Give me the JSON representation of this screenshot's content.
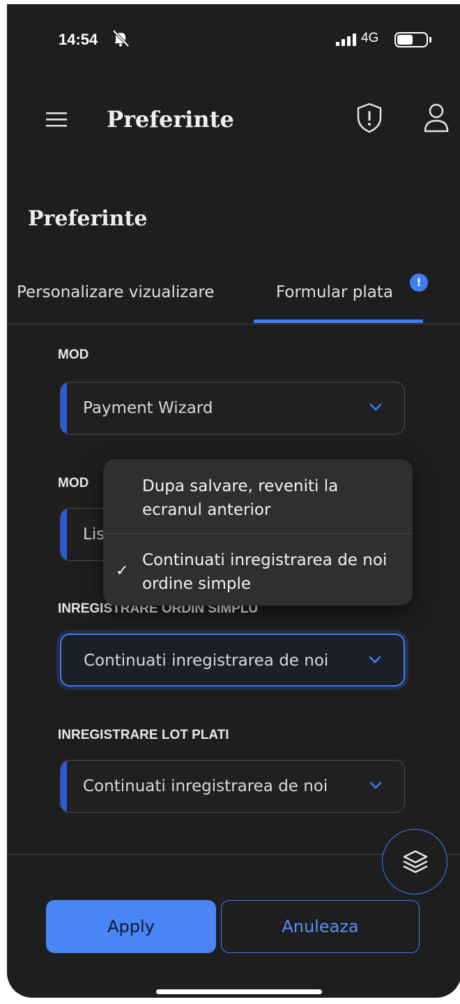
{
  "status_bar": {
    "time": "14:54",
    "network": "4G"
  },
  "header": {
    "title": "Preferinte"
  },
  "page": {
    "title": "Preferinte"
  },
  "tabs": [
    {
      "label": "Personalizare vizualizare",
      "active": false
    },
    {
      "label": "Formular plata",
      "active": true,
      "badge": "!"
    }
  ],
  "form": {
    "mod": {
      "label": "MOD",
      "value": "Payment Wizard"
    },
    "mod_lista": {
      "label_visible": "MOD",
      "value_visible": "Lis"
    },
    "inregistrare_ordin": {
      "label": "INREGISTRARE ORDIN SIMPLU",
      "value": "Continuati inregistrarea de noi"
    },
    "inregistrare_lot": {
      "label": "INREGISTRARE LOT PLATI",
      "value": "Continuati inregistrarea de noi"
    }
  },
  "popup_menu": {
    "options": [
      {
        "label": "Dupa salvare, reveniti la ecranul anterior",
        "selected": false
      },
      {
        "label": "Continuati inregistrarea de noi ordine simple",
        "selected": true
      }
    ]
  },
  "actions": {
    "apply": "Apply",
    "cancel": "Anuleaza"
  },
  "colors": {
    "accent": "#3f7df6",
    "background": "#1e1e1f",
    "popup": "#2f2f31"
  },
  "icons": [
    "menu-icon",
    "shield-alert-icon",
    "user-icon",
    "layers-icon",
    "chevron-down-icon",
    "checkmark-icon",
    "bell-off-icon",
    "signal-icon",
    "battery-icon"
  ]
}
